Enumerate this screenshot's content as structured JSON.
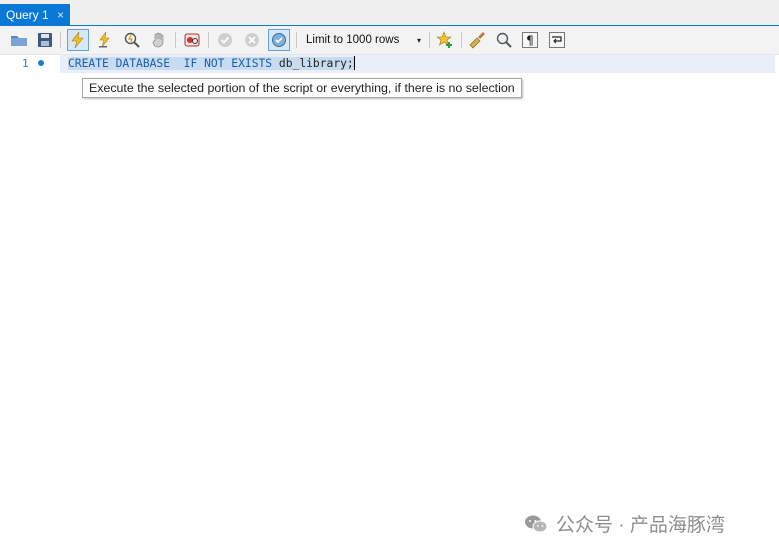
{
  "tabs": [
    {
      "label": "Query 1",
      "close": "×"
    }
  ],
  "toolbar": {
    "icons": [
      "open-folder-icon",
      "save-icon",
      "execute-lightning-icon",
      "execute-current-statement-icon",
      "explain-magnifier-icon",
      "stop-icon",
      "toggle-stop-on-error-icon",
      "commit-icon",
      "rollback-icon",
      "autocommit-icon",
      "add-snippet-icon",
      "beautify-icon",
      "find-icon",
      "invisible-characters-icon",
      "word-wrap-icon"
    ],
    "limit_label": "Limit to 1000 rows",
    "limit_arrow": "▾"
  },
  "editor": {
    "line_number": "1",
    "tokens": {
      "create": "CREATE",
      "database": "DATABASE",
      "if": "IF",
      "not": "NOT",
      "exists": "EXISTS",
      "name": "db_library;"
    }
  },
  "tooltip": "Execute the selected portion of the script or everything, if there is no selection",
  "watermark": "公众号 · 产品海豚湾",
  "colors": {
    "tab_accent": "#0a78d7",
    "keyword": "#1b5ea8",
    "selection": "#c7dcf1",
    "line_number": "#1f7ad6"
  }
}
